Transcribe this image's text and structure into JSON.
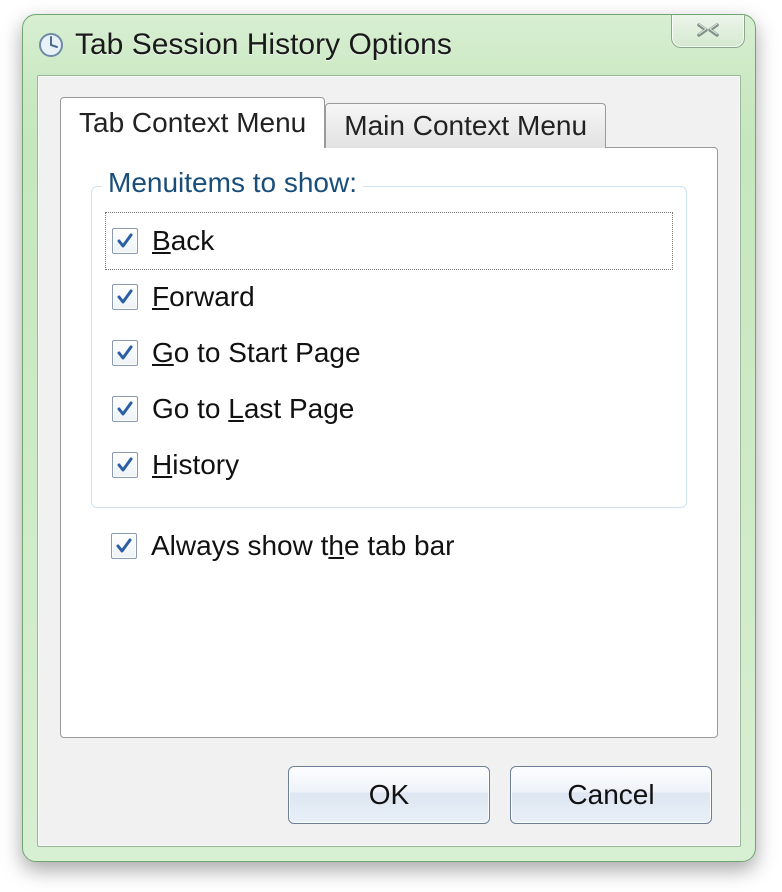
{
  "window": {
    "title": "Tab Session History Options",
    "close_icon": "close-icon"
  },
  "tabs": {
    "items": [
      {
        "label": "Tab Context Menu",
        "active": true
      },
      {
        "label": "Main Context Menu",
        "active": false
      }
    ]
  },
  "group": {
    "legend": "Menuitems to show:",
    "items": [
      {
        "label": "Back",
        "accel_index": 0,
        "checked": true,
        "focused": true
      },
      {
        "label": "Forward",
        "accel_index": 0,
        "checked": true,
        "focused": false
      },
      {
        "label": "Go to Start Page",
        "accel_index": 0,
        "checked": true,
        "focused": false
      },
      {
        "label": "Go to Last Page",
        "accel_index": 6,
        "checked": true,
        "focused": false
      },
      {
        "label": "History",
        "accel_index": 0,
        "checked": true,
        "focused": false
      }
    ]
  },
  "always_show_tab_bar": {
    "label": "Always show the tab bar",
    "accel_index": 13,
    "checked": true
  },
  "buttons": {
    "ok": "OK",
    "cancel": "Cancel"
  }
}
